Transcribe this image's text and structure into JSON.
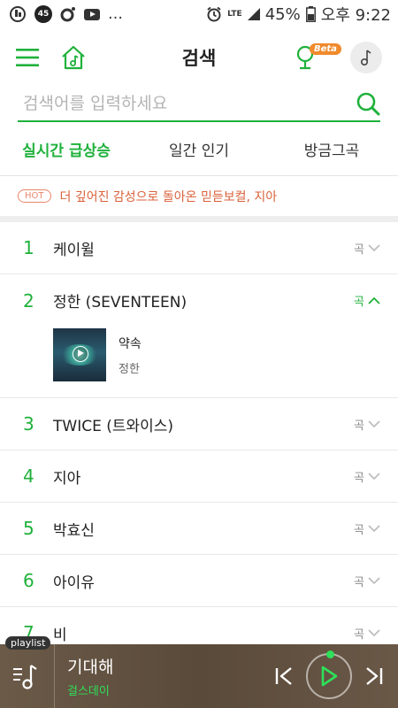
{
  "status_bar": {
    "notif_badge": "45",
    "network": "LTE",
    "battery": "45%",
    "time": "오후 9:22"
  },
  "header": {
    "title": "검색",
    "beta_label": "Beta"
  },
  "search": {
    "placeholder": "검색어를 입력하세요",
    "value": ""
  },
  "tabs": [
    {
      "label": "실시간 급상승",
      "active": true
    },
    {
      "label": "일간 인기",
      "active": false
    },
    {
      "label": "방금그곡",
      "active": false
    }
  ],
  "hot": {
    "badge": "HOT",
    "text": "더 깊어진 감성으로 돌아온 믿듣보컬, 지아"
  },
  "ranking": [
    {
      "rank": "1",
      "name": "케이윌",
      "kind": "곡"
    },
    {
      "rank": "2",
      "name": "정한 (SEVENTEEN)",
      "kind": "곡"
    },
    {
      "rank": "3",
      "name": "TWICE (트와이스)",
      "kind": "곡"
    },
    {
      "rank": "4",
      "name": "지아",
      "kind": "곡"
    },
    {
      "rank": "5",
      "name": "박효신",
      "kind": "곡"
    },
    {
      "rank": "6",
      "name": "아이유",
      "kind": "곡"
    },
    {
      "rank": "7",
      "name": "비",
      "kind": "곡"
    }
  ],
  "expanded_song": {
    "title": "약속",
    "artist": "정한"
  },
  "player": {
    "playlist_label": "playlist",
    "title": "기대해",
    "artist": "걸스데이"
  },
  "colors": {
    "accent": "#1fb13b",
    "hot": "#d9623a",
    "player_bg": "#5a4a3a"
  }
}
